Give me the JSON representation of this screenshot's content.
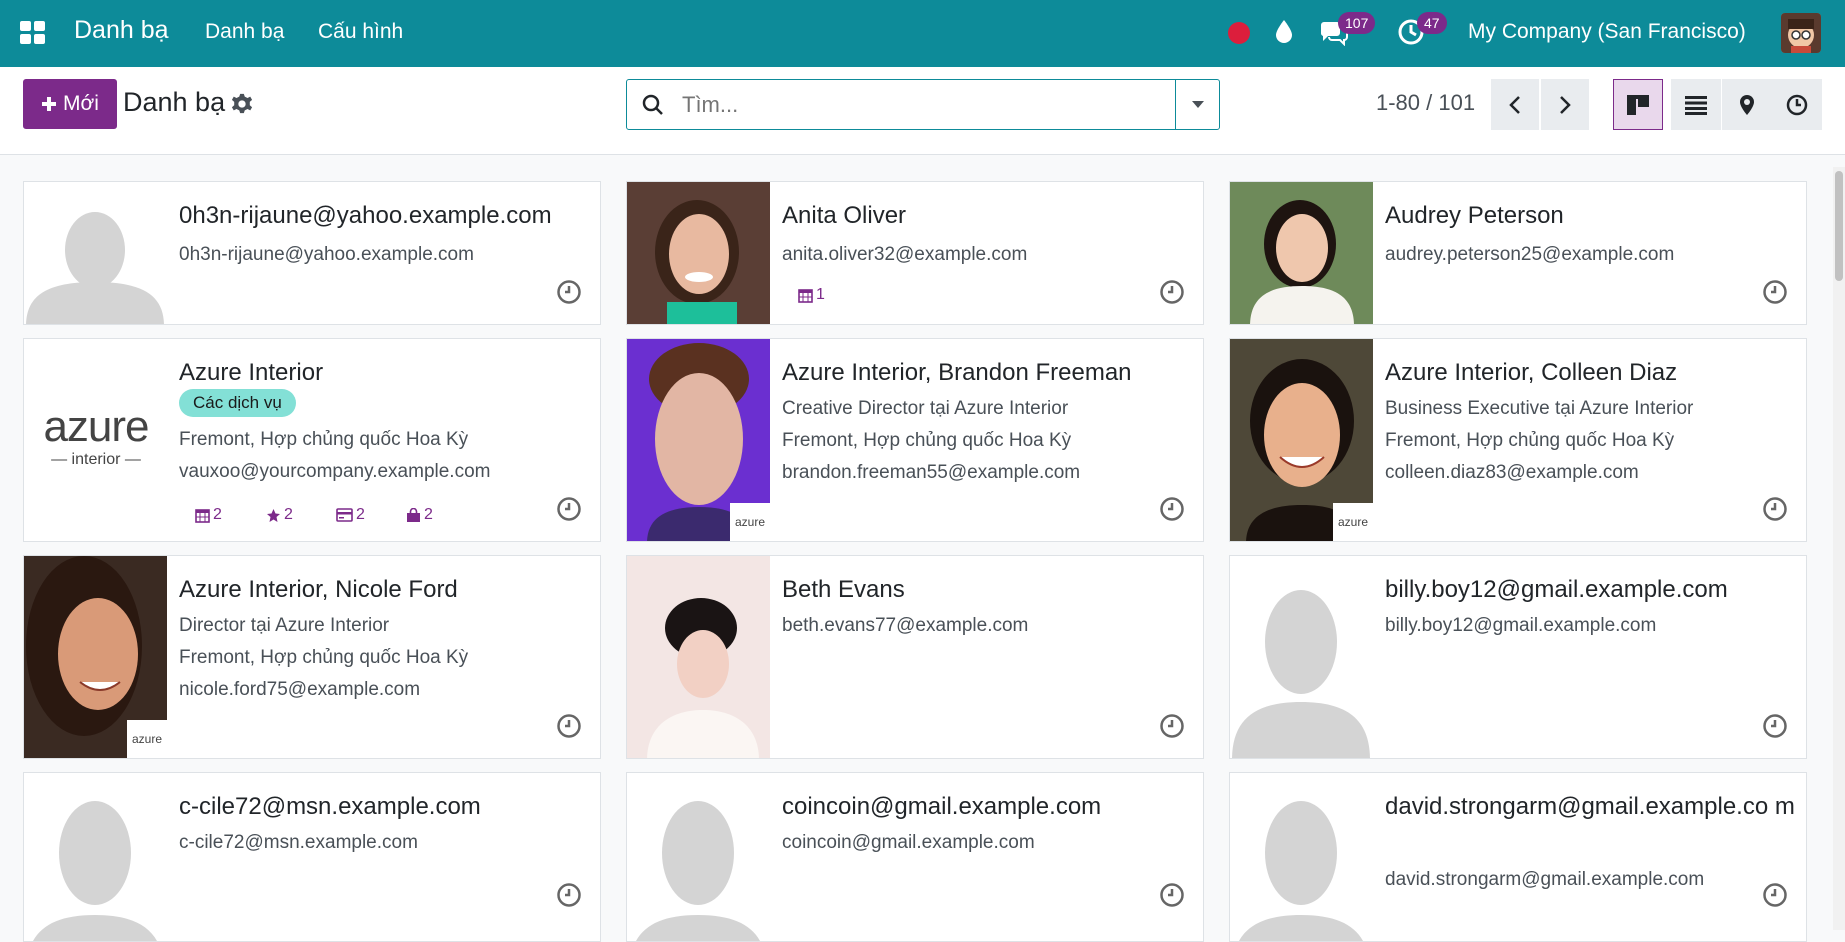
{
  "nav": {
    "app_title": "Danh bạ",
    "menu": [
      "Danh bạ",
      "Cấu hình"
    ],
    "messages_count": "107",
    "activities_count": "47",
    "company": "My Company (San Francisco)"
  },
  "control": {
    "new_label": "Mới",
    "breadcrumb": "Danh bạ",
    "search_placeholder": "Tìm...",
    "pager": "1-80 / 101"
  },
  "cards": [
    {
      "name": "0h3n-rijaune@yahoo.example.com",
      "lines": [
        "0h3n-rijaune@yahoo.example.com"
      ]
    },
    {
      "name": "Anita Oliver",
      "lines": [
        "anita.oliver32@example.com"
      ],
      "meetings": "1"
    },
    {
      "name": "Audrey Peterson",
      "lines": [
        "audrey.peterson25@example.com"
      ]
    },
    {
      "name": "Azure Interior",
      "tag": "Các dịch vụ",
      "lines": [
        "Fremont, Hợp chủng quốc Hoa Kỳ",
        "vauxoo@yourcompany.example.com"
      ],
      "counts": [
        "2",
        "2",
        "2",
        "2"
      ]
    },
    {
      "name": "Azure Interior, Brandon Freeman",
      "lines": [
        "Creative Director tại Azure Interior",
        "Fremont, Hợp chủng quốc Hoa Kỳ",
        "brandon.freeman55@example.com"
      ]
    },
    {
      "name": "Azure Interior, Colleen Diaz",
      "lines": [
        "Business Executive tại Azure Interior",
        "Fremont, Hợp chủng quốc Hoa Kỳ",
        "colleen.diaz83@example.com"
      ]
    },
    {
      "name": "Azure Interior, Nicole Ford",
      "lines": [
        "Director tại Azure Interior",
        "Fremont, Hợp chủng quốc Hoa Kỳ",
        "nicole.ford75@example.com"
      ]
    },
    {
      "name": "Beth Evans",
      "lines": [
        "beth.evans77@example.com"
      ]
    },
    {
      "name": "billy.boy12@gmail.example.com",
      "lines": [
        "billy.boy12@gmail.example.com"
      ]
    },
    {
      "name": "c-cile72@msn.example.com",
      "lines": [
        "c-cile72@msn.example.com"
      ]
    },
    {
      "name": "coincoin@gmail.example.com",
      "lines": [
        "coincoin@gmail.example.com"
      ]
    },
    {
      "name": "david.strongarm@gmail.example.co m",
      "lines": [
        "david.strongarm@gmail.example.com"
      ]
    }
  ],
  "logo_text": {
    "brand": "azure",
    "sub": "interior"
  },
  "colors": {
    "navbar": "#0d8b99",
    "primary": "#7c2a8a",
    "tag": "#83e0d6"
  }
}
